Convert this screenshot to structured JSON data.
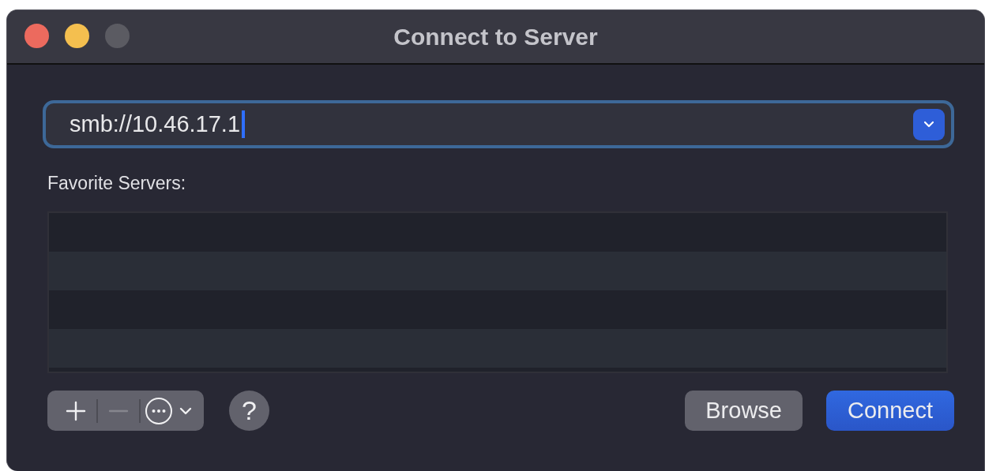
{
  "window": {
    "title": "Connect to Server",
    "controls": [
      {
        "kind": "close",
        "disabled": false
      },
      {
        "kind": "minimize",
        "disabled": false
      },
      {
        "kind": "zoom",
        "disabled": true
      }
    ]
  },
  "address": {
    "value": "smb://10.46.17.1",
    "focused": true
  },
  "favorites": {
    "label": "Favorite Servers:"
  },
  "list_tools": [
    {
      "kind": "add",
      "disabled": false
    },
    {
      "kind": "remove",
      "disabled": true
    },
    {
      "kind": "actions",
      "disabled": false
    }
  ],
  "help": {
    "label": "?"
  },
  "buttons": [
    {
      "label": "Browse",
      "default": false
    },
    {
      "label": "Connect",
      "default": true
    }
  ]
}
